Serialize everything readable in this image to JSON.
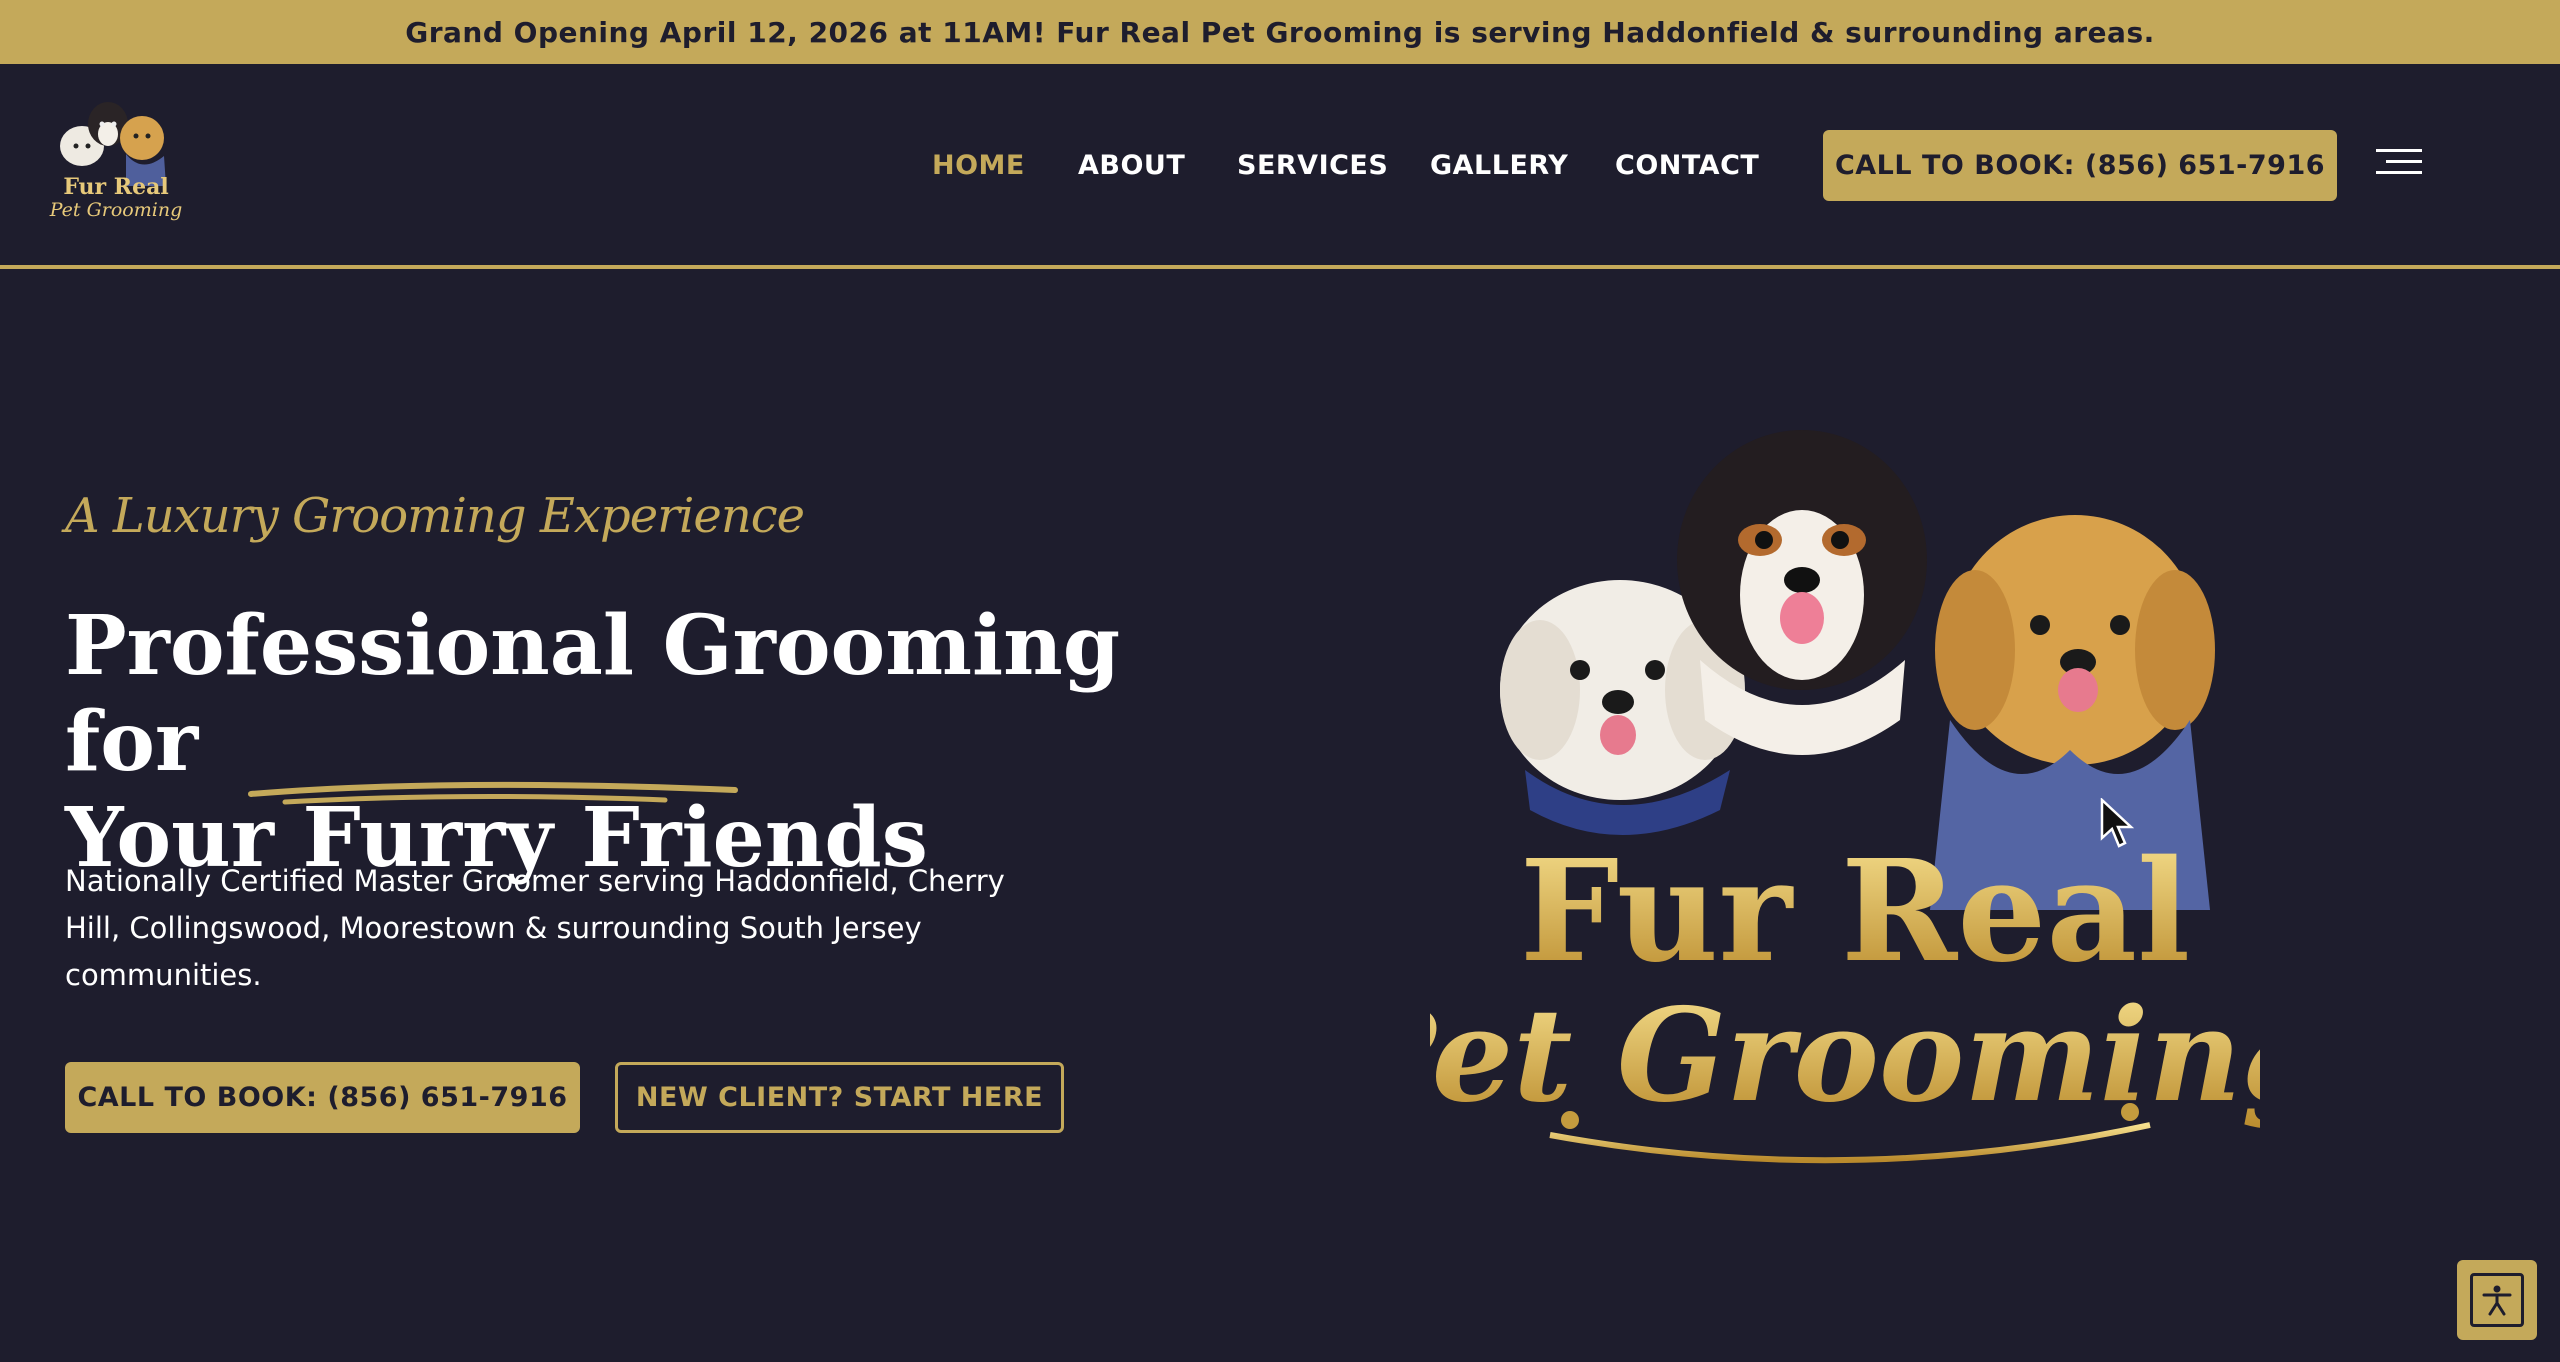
{
  "announcement": "Grand Opening April 12, 2026 at 11AM! Fur Real Pet Grooming is serving Haddonfield & surrounding areas.",
  "header": {
    "logo": {
      "line1": "Fur Real",
      "line2": "Pet Grooming"
    },
    "nav": [
      {
        "label": "HOME",
        "active": true
      },
      {
        "label": "ABOUT",
        "active": false
      },
      {
        "label": "SERVICES",
        "active": false
      },
      {
        "label": "GALLERY",
        "active": false
      },
      {
        "label": "CONTACT",
        "active": false
      }
    ],
    "cta": "CALL TO BOOK: (856) 651-7916",
    "menu_icon": "hamburger-icon"
  },
  "hero": {
    "tagline": "A Luxury Grooming Experience",
    "headline_line1": "Professional Grooming for",
    "headline_line2_prefix": "Your ",
    "headline_highlight": "Furry Friends",
    "description": "Nationally Certified Master Groomer serving Haddonfield, Cherry Hill, Collingswood, Moorestown & surrounding South Jersey communities.",
    "primary_button": "CALL TO BOOK: (856) 651-7916",
    "secondary_button": "NEW CLIENT? START HERE",
    "logo_art": {
      "line1": "Fur Real",
      "line2": "Pet Grooming"
    }
  },
  "accessibility_icon": "accessibility-icon",
  "colors": {
    "background": "#1e1d2d",
    "gold": "#c4a95a",
    "text": "#ffffff"
  }
}
